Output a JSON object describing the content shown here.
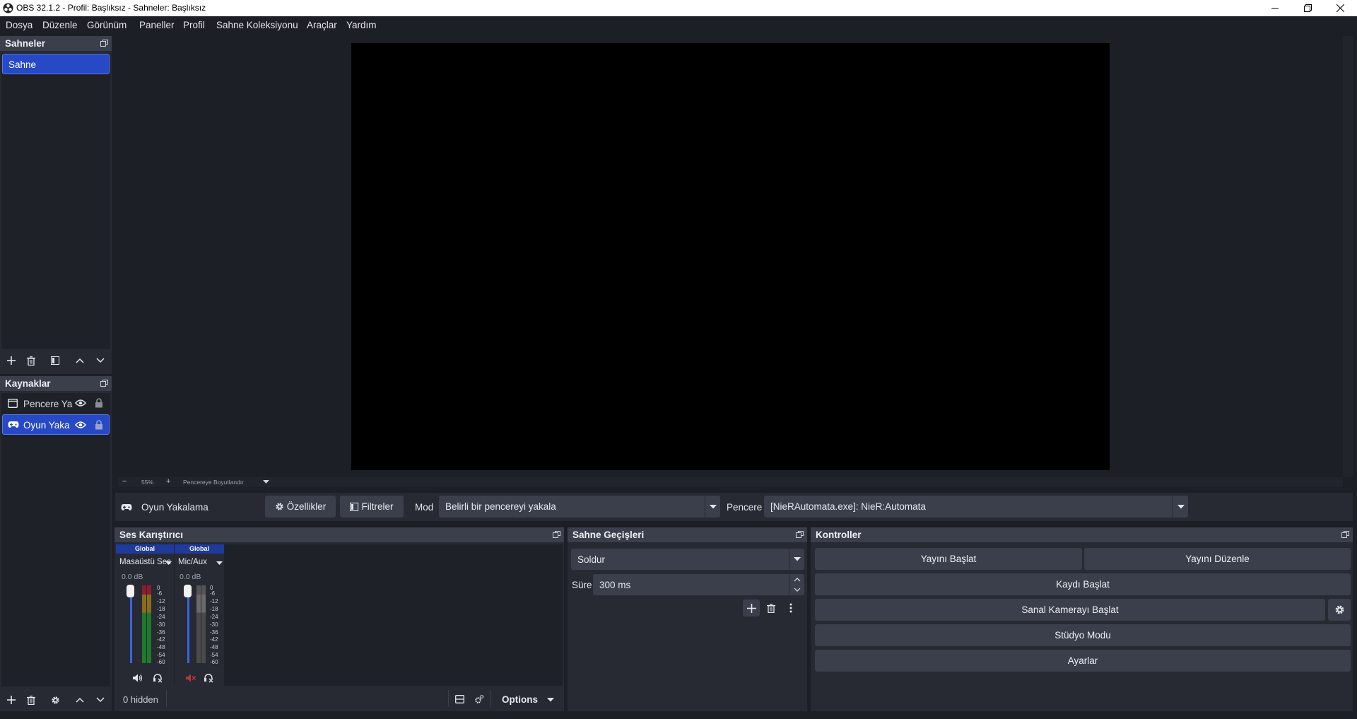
{
  "window": {
    "title": "OBS 32.1.2 - Profil: Başlıksız - Sahneler: Başlıksız"
  },
  "menu": [
    "Dosya",
    "Düzenle",
    "Görünüm",
    "Paneller",
    "Profil",
    "Sahne Koleksiyonu",
    "Araçlar",
    "Yardım"
  ],
  "scenes": {
    "title": "Sahneler",
    "items": [
      "Sahne"
    ]
  },
  "sources": {
    "title": "Kaynaklar",
    "items": [
      {
        "label": "Pencere Ya",
        "icon": "window-icon"
      },
      {
        "label": "Oyun Yaka",
        "icon": "gamepad-icon"
      }
    ]
  },
  "preview": {
    "zoom": "55%",
    "fit_label": "Pencereye Boyutlandır"
  },
  "source_toolbar": {
    "source_name": "Oyun Yakalama",
    "properties_label": "Özellikler",
    "filters_label": "Filtreler",
    "mode_label": "Mod",
    "mode_value": "Belirli bir pencereyi yakala",
    "window_label": "Pencere",
    "window_value": "[NieRAutomata.exe]: NieR:Automata"
  },
  "mixer": {
    "title": "Ses Karıştırıcı",
    "channels": [
      {
        "badge": "Global",
        "name": "Masaüstü Ses",
        "db": "0.0 dB",
        "muted": false
      },
      {
        "badge": "Global",
        "name": "Mic/Aux",
        "db": "0.0 dB",
        "muted": true
      }
    ],
    "scale": [
      "0",
      "-6",
      "-12",
      "-18",
      "-24",
      "-30",
      "-36",
      "-42",
      "-48",
      "-54",
      "-60"
    ],
    "hidden_label": "0 hidden",
    "options_label": "Options"
  },
  "transitions": {
    "title": "Sahne Geçişleri",
    "type": "Soldur",
    "duration_label": "Süre",
    "duration_value": "300 ms"
  },
  "controls": {
    "title": "Kontroller",
    "start_stream": "Yayını Başlat",
    "edit_stream": "Yayını Düzenle",
    "start_record": "Kaydı Başlat",
    "start_vcam": "Sanal Kamerayı Başlat",
    "studio_mode": "Stüdyo Modu",
    "settings": "Ayarlar"
  }
}
